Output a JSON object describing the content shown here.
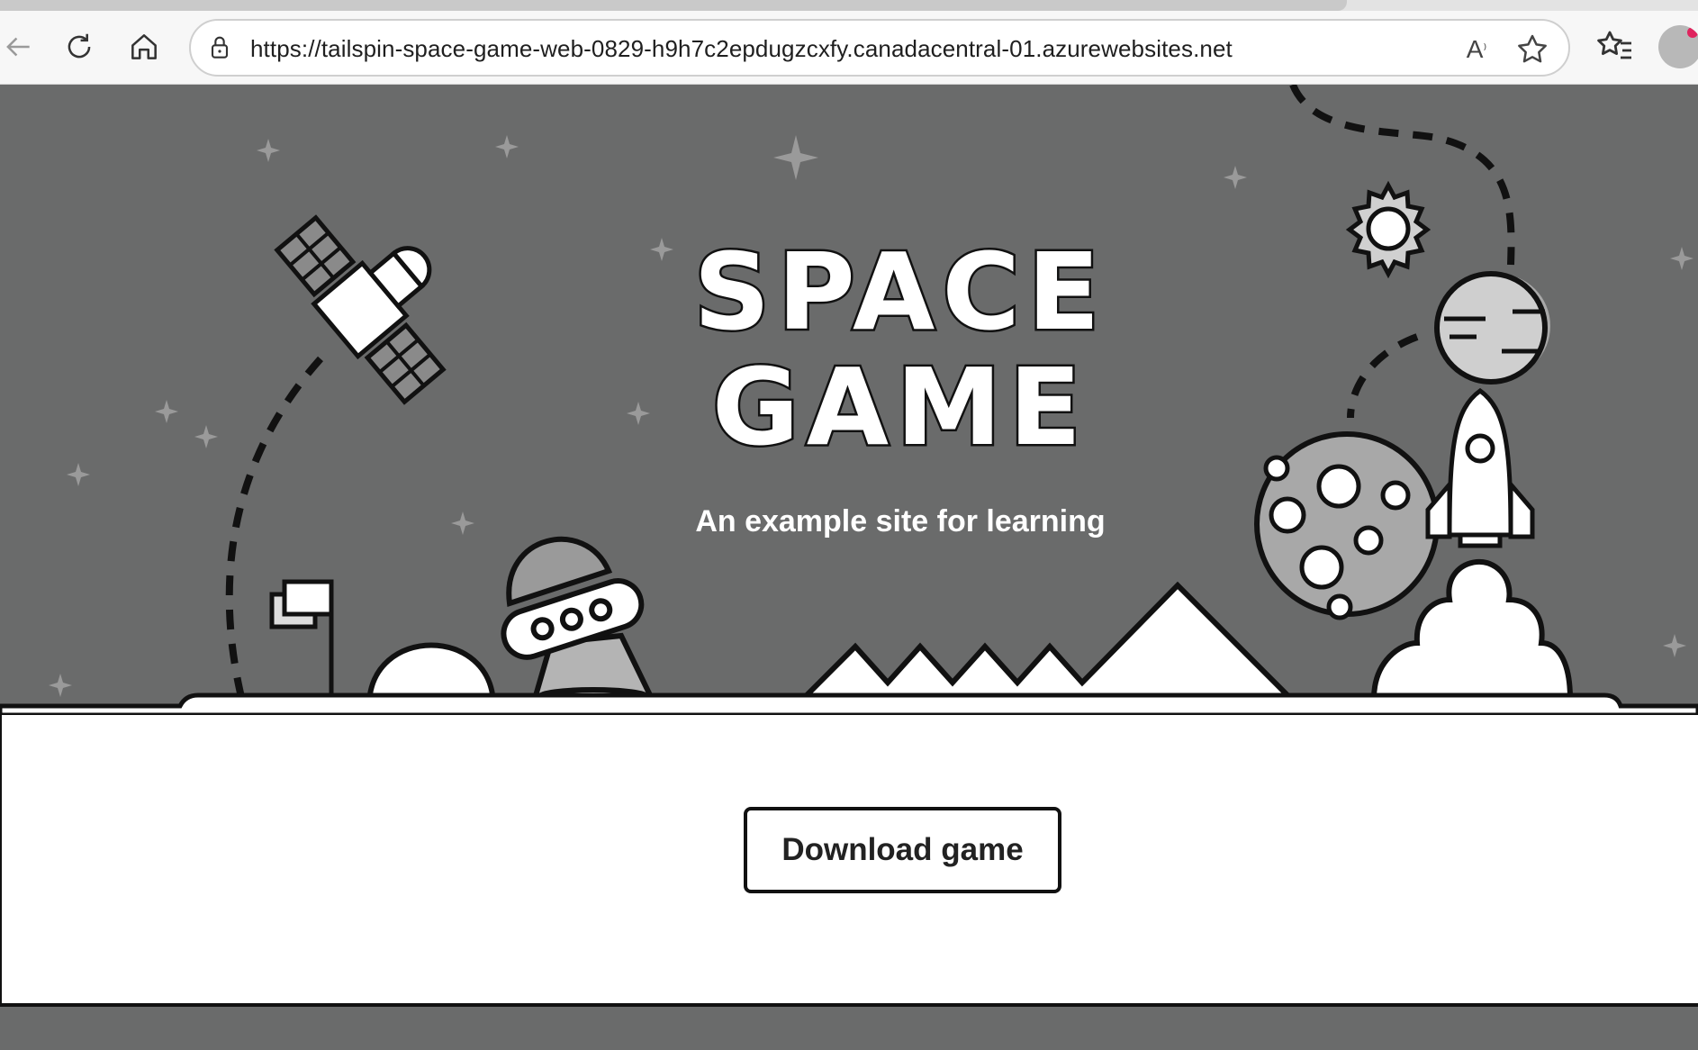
{
  "browser": {
    "url": "https://tailspin-space-game-web-0829-h9h7c2epdugzcxfy.canadacentral-01.azurewebsites.net",
    "icons": [
      "back-icon",
      "refresh-icon",
      "home-icon",
      "lock-icon",
      "read-aloud-icon",
      "favorite-star-icon",
      "favorites-icon",
      "profile-avatar"
    ]
  },
  "hero": {
    "title_line1": "SPACE",
    "title_line2": "GAME",
    "subtitle": "An example site for learning"
  },
  "main": {
    "download_label": "Download game"
  },
  "colors": {
    "hero_bg": "#6a6b6b",
    "ground": "#ffffff",
    "outline": "#111111"
  }
}
